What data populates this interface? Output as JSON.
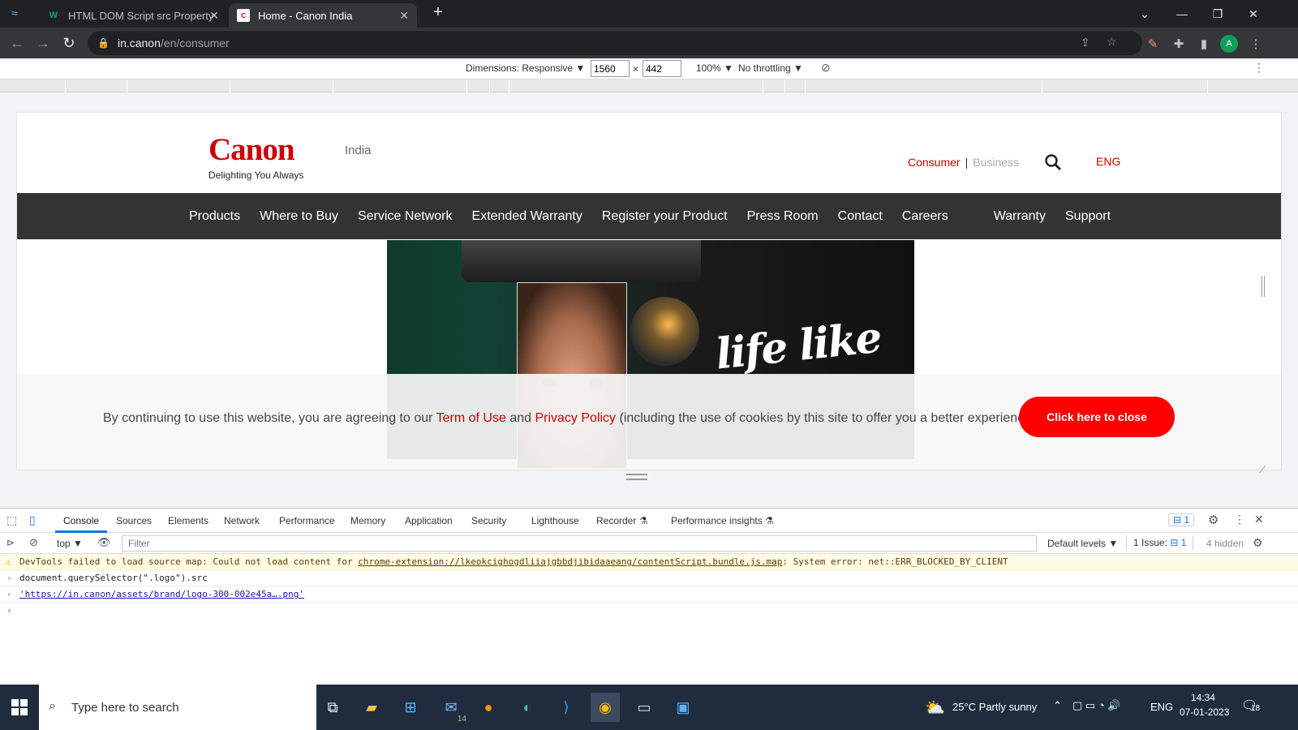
{
  "browser": {
    "tabs": [
      {
        "icon": "W",
        "title": "HTML DOM Script src Property"
      },
      {
        "icon": "C",
        "title": "Home - Canon India"
      }
    ],
    "url_host": "in.canon",
    "url_path": "/en/consumer",
    "avatar_letter": "A"
  },
  "device_toolbar": {
    "dimensions_label": "Dimensions: Responsive ▼",
    "width": "1560",
    "times": "×",
    "height": "442",
    "zoom": "100% ▼",
    "throttling": "No throttling ▼"
  },
  "site": {
    "logo_text": "Canon",
    "tagline": "Delighting You Always",
    "region": "India",
    "segment_consumer": "Consumer",
    "segment_separator": "|",
    "segment_business": "Business",
    "language": "ENG",
    "nav": [
      "Products",
      "Where to Buy",
      "Service Network",
      "Extended Warranty",
      "Register your Product",
      "Press Room",
      "Contact",
      "Careers",
      "Warranty",
      "Support"
    ],
    "hero_text": "life like",
    "cookie": {
      "before": "By continuing to use this website, you are agreeing to our ",
      "terms": "Term of Use",
      "and": " and ",
      "privacy": "Privacy Policy",
      "after": " (including the use of cookies by this site to offer you a better experience).",
      "button": "Click here to close"
    }
  },
  "devtools": {
    "tabs": [
      "Console",
      "Sources",
      "Elements",
      "Network",
      "Performance",
      "Memory",
      "Application",
      "Security",
      "Lighthouse",
      "Recorder ⚗",
      "Performance insights ⚗"
    ],
    "issues_badge": "1",
    "context": "top ▼",
    "filter_placeholder": "Filter",
    "default_levels": "Default levels ▼",
    "issues_label": "1 Issue:",
    "issues_count": "1",
    "hidden": "4 hidden",
    "warning_prefix": "DevTools failed to load source map: Could not load content for ",
    "warning_link": "chrome-extension://lkeokcighogdliiajgbbdjibidaaeang/contentScript.bundle.js.map",
    "warning_suffix": ": System error: net::ERR_BLOCKED_BY_CLIENT",
    "input_line": "document.querySelector(\".logo\").src",
    "output_line": "'https://in.canon/assets/brand/logo-300-002e45a….png'"
  },
  "taskbar": {
    "search_placeholder": "Type here to search",
    "mail_badge": "14",
    "weather": "25°C  Partly sunny",
    "lang": "ENG",
    "time": "14:34",
    "date": "07-01-2023",
    "notifications": "18"
  }
}
